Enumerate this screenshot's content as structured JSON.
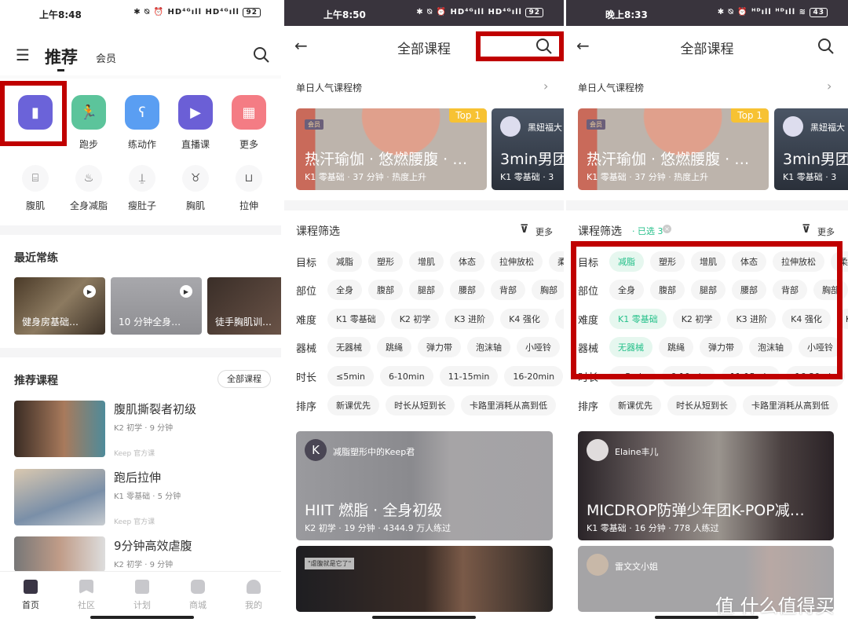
{
  "panel1": {
    "status": {
      "time": "上午8:48",
      "icons": "✱ ⍉ ⏰ HD⁴ᴳıll HD⁴ᴳıll",
      "battery": "92"
    },
    "header": {
      "tab_active": "推荐",
      "tab_other": "会员"
    },
    "quick_entries": [
      {
        "label": "",
        "icon": "bookmark-icon",
        "color": "#6b63d9"
      },
      {
        "label": "跑步",
        "icon": "running-icon",
        "color": "#5cc49b"
      },
      {
        "label": "练动作",
        "icon": "squat-icon",
        "color": "#5a9ef2"
      },
      {
        "label": "直播课",
        "icon": "tv-icon",
        "color": "#6b5fd6"
      },
      {
        "label": "更多",
        "icon": "grid-icon",
        "color": "#f47c84"
      }
    ],
    "body_parts": [
      {
        "label": "腹肌",
        "icon": "abs-icon"
      },
      {
        "label": "全身减脂",
        "icon": "flame-icon"
      },
      {
        "label": "瘦肚子",
        "icon": "belly-icon"
      },
      {
        "label": "胸肌",
        "icon": "chest-icon"
      },
      {
        "label": "拉伸",
        "icon": "stretch-icon"
      }
    ],
    "recent": {
      "title": "最近常练",
      "items": [
        "健身房基础…",
        "10 分钟全身…",
        "徒手胸肌训…"
      ]
    },
    "recommended": {
      "title": "推荐课程",
      "all_button": "全部课程",
      "items": [
        {
          "title": "腹肌撕裂者初级",
          "meta": "K2 初学 · 9 分钟",
          "source": "Keep 官方课"
        },
        {
          "title": "跑后拉伸",
          "meta": "K1 零基础 · 5 分钟",
          "source": "Keep 官方课"
        },
        {
          "title": "9分钟高效虐腹",
          "meta": "K2 初学 · 9 分钟",
          "source": ""
        }
      ]
    },
    "bottom_nav": [
      "首页",
      "社区",
      "计划",
      "商城",
      "我的"
    ]
  },
  "panel2": {
    "status": {
      "time": "上午8:50",
      "icons": "✱ ⍉ ⏰ HD⁴ᴳıll HD⁴ᴳıll",
      "battery": "92"
    },
    "title": "全部课程",
    "ranking_title": "单日人气课程榜",
    "rank_card": {
      "badge": "会员",
      "top": "Top 1",
      "title": "热汗瑜伽 · 悠燃腰腹 · …",
      "meta": "K1 零基础 · 37 分钟 · 热度上升"
    },
    "rank_card2": {
      "author": "黑妞福大",
      "title": "3min男团",
      "meta": "K1 零基础 · 3"
    },
    "filter_title": "课程筛选",
    "more": "更多",
    "filters": [
      {
        "label": "目标",
        "chips": [
          "减脂",
          "塑形",
          "增肌",
          "体态",
          "拉伸放松",
          "柔韧"
        ]
      },
      {
        "label": "部位",
        "chips": [
          "全身",
          "腹部",
          "腿部",
          "腰部",
          "背部",
          "胸部"
        ]
      },
      {
        "label": "难度",
        "chips": [
          "K1 零基础",
          "K2 初学",
          "K3 进阶",
          "K4 强化",
          "K5 挑"
        ]
      },
      {
        "label": "器械",
        "chips": [
          "无器械",
          "跳绳",
          "弹力带",
          "泡沫轴",
          "小哑铃",
          "健"
        ]
      },
      {
        "label": "时长",
        "chips": [
          "≤5min",
          "6-10min",
          "11-15min",
          "16-20min",
          "21-"
        ]
      },
      {
        "label": "排序",
        "chips": [
          "新课优先",
          "时长从短到长",
          "卡路里消耗从高到低"
        ]
      }
    ],
    "course_card": {
      "author": "减脂塑形中的Keep君",
      "title": "HIIT 燃脂 · 全身初级",
      "meta": "K2 初学 · 19 分钟 · 4344.9 万人练过"
    },
    "course_card2": {
      "tag": "\"虐腹就是它了\""
    }
  },
  "panel3": {
    "status": {
      "time": "晚上8:33",
      "icons": "✱ ⍉ ⏰ ᴴᴰıll ᴴᴰıll ≋",
      "battery": "43"
    },
    "title": "全部课程",
    "ranking_title": "单日人气课程榜",
    "rank_card": {
      "badge": "会员",
      "top": "Top 1",
      "title": "热汗瑜伽 · 悠燃腰腹 · …",
      "meta": "K1 零基础 · 37 分钟 · 热度上升"
    },
    "rank_card2": {
      "author": "黑妞福大",
      "title": "3min男团",
      "meta": "K1 零基础 · 3"
    },
    "filter_title": "课程筛选",
    "selected_count": "· 已选 3",
    "more": "更多",
    "filters": [
      {
        "label": "目标",
        "chips": [
          "减脂",
          "塑形",
          "增肌",
          "体态",
          "拉伸放松",
          "柔韧"
        ],
        "selected": [
          0
        ]
      },
      {
        "label": "部位",
        "chips": [
          "全身",
          "腹部",
          "腿部",
          "腰部",
          "背部",
          "胸部"
        ],
        "selected": []
      },
      {
        "label": "难度",
        "chips": [
          "K1 零基础",
          "K2 初学",
          "K3 进阶",
          "K4 强化",
          "K5"
        ],
        "selected": [
          0
        ]
      },
      {
        "label": "器械",
        "chips": [
          "无器械",
          "跳绳",
          "弹力带",
          "泡沫轴",
          "小哑铃",
          "健"
        ],
        "selected": [
          0
        ]
      },
      {
        "label": "时长",
        "chips": [
          "≤5min",
          "6-10min",
          "11-15min",
          "16-20min",
          "21-"
        ],
        "selected": []
      },
      {
        "label": "排序",
        "chips": [
          "新课优先",
          "时长从短到长",
          "卡路里消耗从高到低"
        ],
        "selected": []
      }
    ],
    "course_card": {
      "author": "Elaine丰儿",
      "title": "MICDROP防弹少年团K-POP减…",
      "meta": "K1 零基础 · 16 分钟 · 778 人练过"
    },
    "course_card2": {
      "author": "雷文文小姐"
    },
    "watermark": "值 什么值得买"
  },
  "colors": {
    "highlight_box": "#c00000",
    "selected_chip": "#25c08a",
    "top_badge": "#f7c233"
  }
}
